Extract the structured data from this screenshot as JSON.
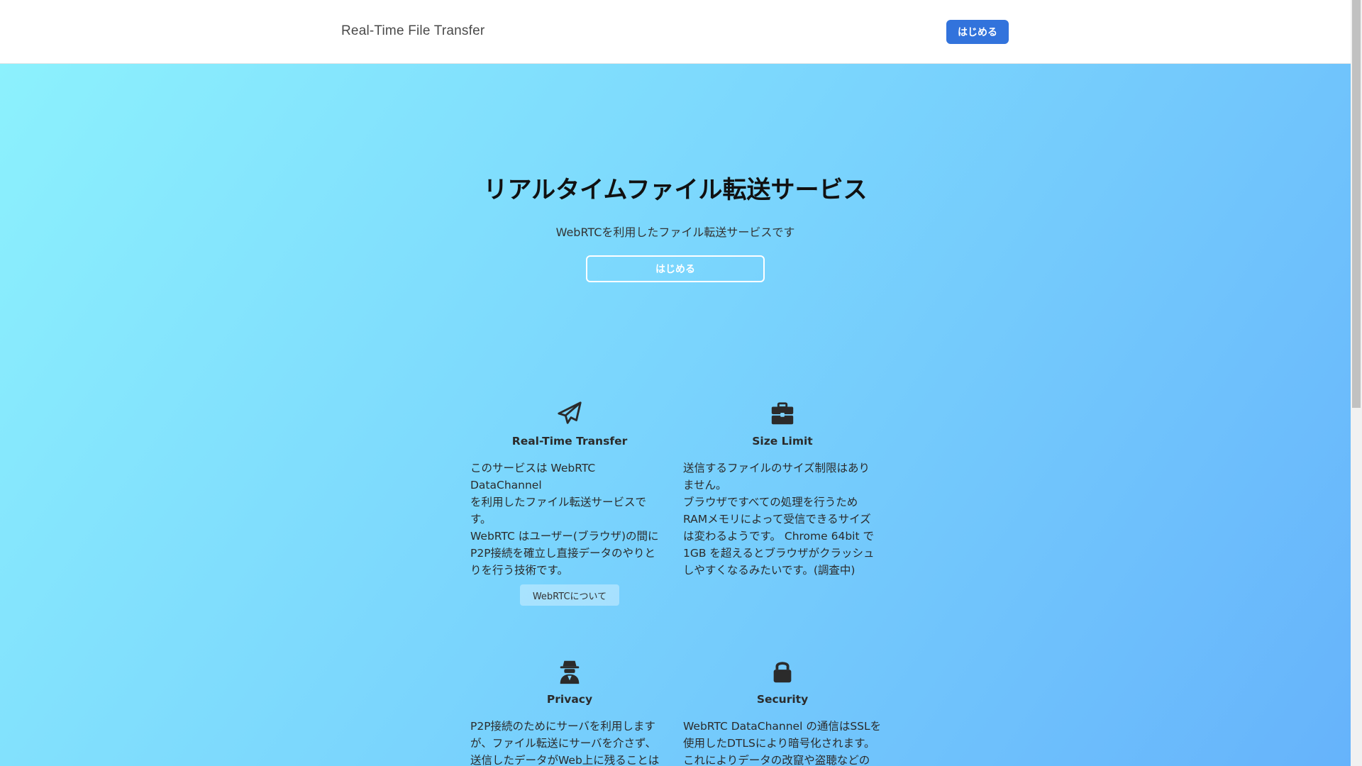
{
  "navbar": {
    "brand": "Real-Time File Transfer",
    "start_label": "はじめる"
  },
  "hero": {
    "title": "リアルタイムファイル転送サービス",
    "subtitle": "WebRTCを利用したファイル転送サービスです",
    "start_label": "はじめる"
  },
  "features": [
    {
      "icon": "paper-plane-icon",
      "title": "Real-Time Transfer",
      "description": "このサービスは WebRTC DataChannel\nを利用したファイル転送サービスで\nす。\nWebRTC はユーザー(ブラウザ)の間に\nP2P接続を確立し直接データのやりと\nりを行う技術です。",
      "link_label": "WebRTCについて"
    },
    {
      "icon": "briefcase-icon",
      "title": "Size Limit",
      "description": "送信するファイルのサイズ制限はあり\nません。\nブラウザですべての処理を行うため\nRAMメモリによって受信できるサイズ\nは変わるようです。 Chrome 64bit で\n1GB を超えるとブラウザがクラッシュ\nしやすくなるみたいです。(調査中)"
    },
    {
      "icon": "user-secret-icon",
      "title": "Privacy",
      "description": "P2P接続のためにサーバを利用します\nが、ファイル転送にサーバを介さず、\n送信したデータがWeb上に残ることは"
    },
    {
      "icon": "lock-icon",
      "title": "Security",
      "description": "WebRTC DataChannel の通信はSSLを\n使用したDTLSにより暗号化されます。\nこれによりデータの改竄や盗聴などの"
    }
  ],
  "colors": {
    "primary": "#3273dc",
    "hero_gradient_start": "#8cf1fd",
    "hero_gradient_end": "#66b3fb"
  }
}
